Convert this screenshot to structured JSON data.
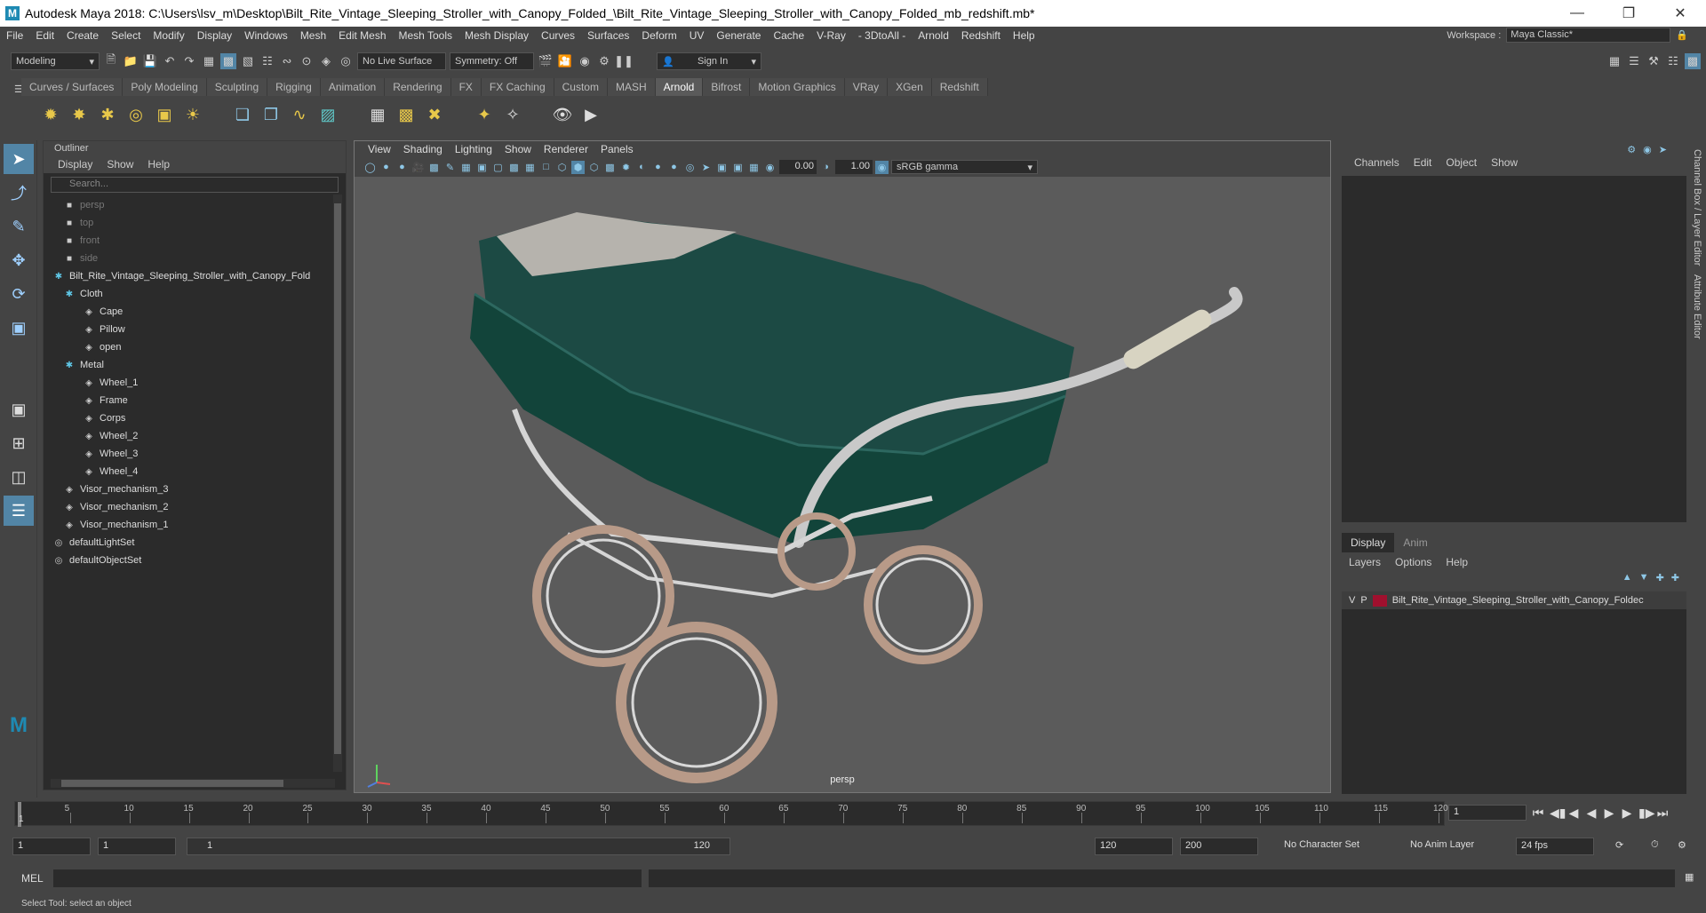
{
  "window": {
    "title": "Autodesk Maya 2018: C:\\Users\\lsv_m\\Desktop\\Bilt_Rite_Vintage_Sleeping_Stroller_with_Canopy_Folded_\\Bilt_Rite_Vintage_Sleeping_Stroller_with_Canopy_Folded_mb_redshift.mb*",
    "logo": "M"
  },
  "menubar": [
    "File",
    "Edit",
    "Create",
    "Select",
    "Modify",
    "Display",
    "Windows",
    "Mesh",
    "Edit Mesh",
    "Mesh Tools",
    "Mesh Display",
    "Curves",
    "Surfaces",
    "Deform",
    "UV",
    "Generate",
    "Cache",
    "V-Ray",
    "- 3DtoAll -",
    "Arnold",
    "Redshift",
    "Help"
  ],
  "workspace": {
    "label": "Workspace :",
    "value": "Maya Classic*"
  },
  "statusline": {
    "mode": "Modeling",
    "live_surface": "No Live Surface",
    "symmetry": "Symmetry: Off",
    "sign_in": "Sign In"
  },
  "shelf_tabs": [
    "Curves / Surfaces",
    "Poly Modeling",
    "Sculpting",
    "Rigging",
    "Animation",
    "Rendering",
    "FX",
    "FX Caching",
    "Custom",
    "MASH",
    "Arnold",
    "Bifrost",
    "Motion Graphics",
    "VRay",
    "XGen",
    "Redshift"
  ],
  "shelf_active": "Arnold",
  "outliner": {
    "title": "Outliner",
    "menu": [
      "Display",
      "Show",
      "Help"
    ],
    "search_placeholder": "Search...",
    "items": [
      {
        "label": "persp",
        "indent": 1,
        "dim": true
      },
      {
        "label": "top",
        "indent": 1,
        "dim": true
      },
      {
        "label": "front",
        "indent": 1,
        "dim": true
      },
      {
        "label": "side",
        "indent": 1,
        "dim": true
      },
      {
        "label": "Bilt_Rite_Vintage_Sleeping_Stroller_with_Canopy_Fold",
        "indent": 0,
        "dim": false
      },
      {
        "label": "Cloth",
        "indent": 1,
        "dim": false
      },
      {
        "label": "Cape",
        "indent": 2,
        "dim": false
      },
      {
        "label": "Pillow",
        "indent": 2,
        "dim": false
      },
      {
        "label": "open",
        "indent": 2,
        "dim": false
      },
      {
        "label": "Metal",
        "indent": 1,
        "dim": false
      },
      {
        "label": "Wheel_1",
        "indent": 2,
        "dim": false
      },
      {
        "label": "Frame",
        "indent": 2,
        "dim": false
      },
      {
        "label": "Corps",
        "indent": 2,
        "dim": false
      },
      {
        "label": "Wheel_2",
        "indent": 2,
        "dim": false
      },
      {
        "label": "Wheel_3",
        "indent": 2,
        "dim": false
      },
      {
        "label": "Wheel_4",
        "indent": 2,
        "dim": false
      },
      {
        "label": "Visor_mechanism_3",
        "indent": 1,
        "dim": false
      },
      {
        "label": "Visor_mechanism_2",
        "indent": 1,
        "dim": false
      },
      {
        "label": "Visor_mechanism_1",
        "indent": 1,
        "dim": false
      },
      {
        "label": "defaultLightSet",
        "indent": 0,
        "dim": false
      },
      {
        "label": "defaultObjectSet",
        "indent": 0,
        "dim": false
      }
    ]
  },
  "viewport": {
    "menu": [
      "View",
      "Shading",
      "Lighting",
      "Show",
      "Renderer",
      "Panels"
    ],
    "exposure": "0.00",
    "gamma": "1.00",
    "color_space": "sRGB gamma",
    "camera": "persp"
  },
  "channelbox": {
    "menu": [
      "Channels",
      "Edit",
      "Object",
      "Show"
    ]
  },
  "layers": {
    "tabs": [
      "Display",
      "Anim"
    ],
    "menu": [
      "Layers",
      "Options",
      "Help"
    ],
    "row": {
      "v": "V",
      "p": "P",
      "color": "#a0102e",
      "name": "Bilt_Rite_Vintage_Sleeping_Stroller_with_Canopy_Foldec"
    }
  },
  "side_tabs": [
    "Channel Box / Layer Editor",
    "Attribute Editor"
  ],
  "timeline": {
    "ticks": [
      "5",
      "10",
      "15",
      "20",
      "25",
      "30",
      "35",
      "40",
      "45",
      "50",
      "55",
      "60",
      "65",
      "70",
      "75",
      "80",
      "85",
      "90",
      "95",
      "100",
      "105",
      "110",
      "115",
      "120"
    ],
    "current": "1",
    "current_frame_field": "1"
  },
  "range": {
    "start": "1",
    "inner_start": "1",
    "slider_start": "1",
    "slider_end": "120",
    "end": "120",
    "outer_end": "200",
    "character_set": "No Character Set",
    "anim_layer": "No Anim Layer",
    "fps": "24 fps"
  },
  "mel": {
    "label": "MEL"
  },
  "help_line": "Select Tool: select an object"
}
